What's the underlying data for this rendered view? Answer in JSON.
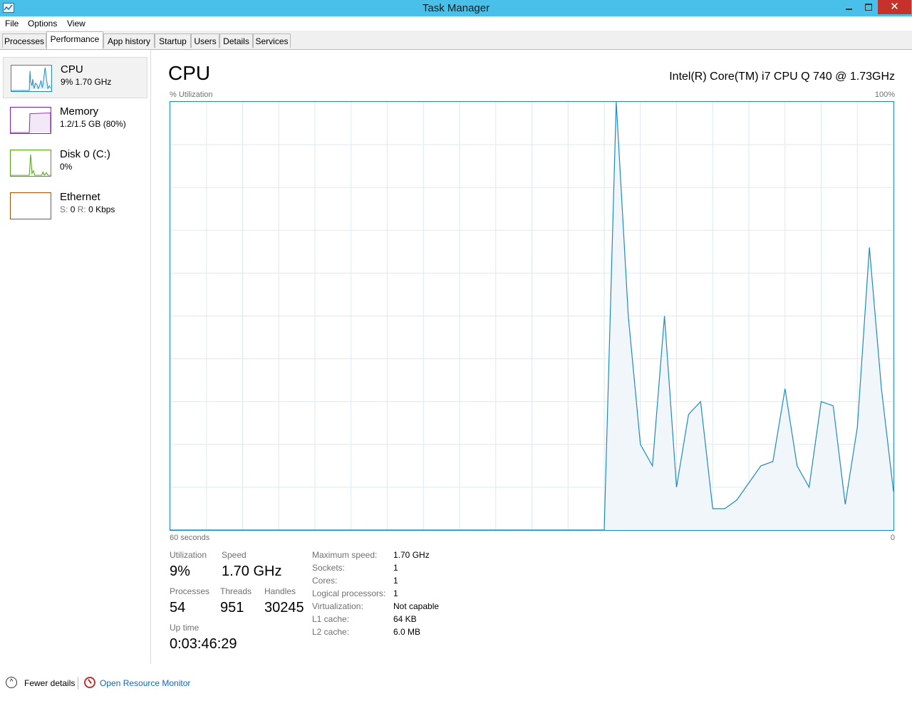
{
  "window": {
    "title": "Task Manager"
  },
  "menu": {
    "items": [
      {
        "label": "File"
      },
      {
        "label": "Options"
      },
      {
        "label": "View"
      }
    ]
  },
  "tabs": [
    {
      "label": "Processes"
    },
    {
      "label": "Performance",
      "active": true
    },
    {
      "label": "App history"
    },
    {
      "label": "Startup"
    },
    {
      "label": "Users"
    },
    {
      "label": "Details"
    },
    {
      "label": "Services"
    }
  ],
  "sidebar": {
    "items": [
      {
        "title": "CPU",
        "sub": "9%  1.70 GHz",
        "color": "#1c8bc5",
        "selected": true
      },
      {
        "title": "Memory",
        "sub": "1.2/1.5 GB (80%)",
        "color": "#8b1bbd"
      },
      {
        "title": "Disk 0 (C:)",
        "sub": "0%",
        "color": "#4da60c"
      },
      {
        "title": "Ethernet",
        "sub_s_label": "S:",
        "sub_s_value": "0",
        "sub_r_label": "R:",
        "sub_r_value": "0 Kbps",
        "color": "#a74f01"
      }
    ]
  },
  "main": {
    "title": "CPU",
    "cpu_name": "Intel(R) Core(TM) i7 CPU Q 740 @ 1.73GHz",
    "y_label": "% Utilization",
    "y_max_label": "100%",
    "x_left_label": "60 seconds",
    "x_right_label": "0"
  },
  "stats": {
    "utilization_label": "Utilization",
    "utilization_value": "9%",
    "speed_label": "Speed",
    "speed_value": "1.70 GHz",
    "processes_label": "Processes",
    "processes_value": "54",
    "threads_label": "Threads",
    "threads_value": "951",
    "handles_label": "Handles",
    "handles_value": "30245",
    "uptime_label": "Up time",
    "uptime_value": "0:03:46:29"
  },
  "specs": [
    {
      "label": "Maximum speed:",
      "value": "1.70 GHz"
    },
    {
      "label": "Sockets:",
      "value": "1"
    },
    {
      "label": "Cores:",
      "value": "1"
    },
    {
      "label": "Logical processors:",
      "value": "1"
    },
    {
      "label": "Virtualization:",
      "value": "Not capable"
    },
    {
      "label": "L1 cache:",
      "value": "64 KB"
    },
    {
      "label": "L2 cache:",
      "value": "6.0 MB"
    }
  ],
  "footer": {
    "fewer_details": "Fewer details",
    "resource_monitor": "Open Resource Monitor"
  },
  "chart_data": {
    "type": "area",
    "x": [
      -60,
      -58,
      -56,
      -54,
      -52,
      -50,
      -48,
      -46,
      -44,
      -42,
      -40,
      -38,
      -36,
      -34,
      -32,
      -30,
      -28,
      -26,
      -24,
      -23,
      -22,
      -21,
      -20,
      -19,
      -18,
      -17,
      -16,
      -15,
      -14,
      -13,
      -12,
      -11,
      -10,
      -9,
      -8,
      -7,
      -6,
      -5,
      -4,
      -3,
      -2,
      -1,
      0
    ],
    "values": [
      0,
      0,
      0,
      0,
      0,
      0,
      0,
      0,
      0,
      0,
      0,
      0,
      0,
      0,
      0,
      0,
      0,
      0,
      0,
      100,
      50,
      20,
      15,
      50,
      10,
      27,
      30,
      5,
      5,
      7,
      11,
      15,
      16,
      33,
      15,
      10,
      30,
      29,
      6,
      24,
      66,
      33,
      9
    ],
    "ylim": [
      0,
      100
    ],
    "xlim": [
      -60,
      0
    ],
    "grid": true,
    "line_color": "#1c8bc5",
    "fill_color": "#f1f6fa"
  }
}
